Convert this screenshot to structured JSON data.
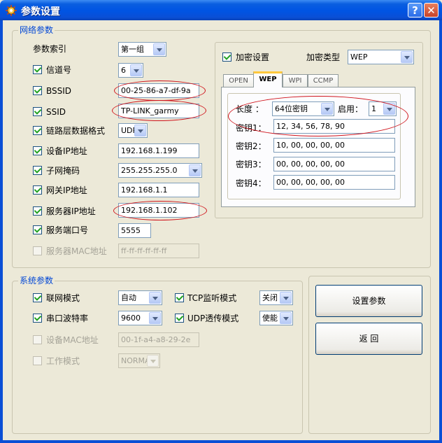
{
  "window": {
    "title": "参数设置"
  },
  "network": {
    "group_label": "网络参数",
    "param_index": {
      "label": "参数索引",
      "value": "第一组"
    },
    "channel": {
      "label": "信道号",
      "value": "6"
    },
    "bssid": {
      "label": "BSSID",
      "value": "00-25-86-a7-df-9a"
    },
    "ssid": {
      "label": "SSID",
      "value": "TP-LINK_garmy"
    },
    "link_format": {
      "label": "链路层数据格式",
      "value": "UDP"
    },
    "device_ip": {
      "label": "设备IP地址",
      "value": "192.168.1.199"
    },
    "subnet_mask": {
      "label": "子网掩码",
      "value": "255.255.255.0"
    },
    "gateway_ip": {
      "label": "网关IP地址",
      "value": "192.168.1.1"
    },
    "server_ip": {
      "label": "服务器IP地址",
      "value": "192.168.1.102"
    },
    "server_port": {
      "label": "服务端口号",
      "value": "5555"
    },
    "server_mac": {
      "label": "服务器MAC地址",
      "value": "ff-ff-ff-ff-ff-ff"
    }
  },
  "encryption": {
    "label": "加密设置",
    "type_label": "加密类型",
    "type_value": "WEP",
    "tabs": [
      "OPEN",
      "WEP",
      "WPI",
      "CCMP"
    ],
    "length_label": "长度 ：",
    "length_value": "64位密钥",
    "enable_label": "启用：",
    "enable_value": "1",
    "keys": [
      {
        "label": "密钥1：",
        "value": "12, 34, 56, 78, 90"
      },
      {
        "label": "密钥2：",
        "value": "10, 00, 00, 00, 00"
      },
      {
        "label": "密钥3：",
        "value": "00, 00, 00, 00, 00"
      },
      {
        "label": "密钥4：",
        "value": "00, 00, 00, 00, 00"
      }
    ]
  },
  "system": {
    "group_label": "系统参数",
    "network_mode": {
      "label": "联网模式",
      "value": "自动"
    },
    "tcp_listen": {
      "label": "TCP监听模式",
      "value": "关闭"
    },
    "baud_rate": {
      "label": "串口波特率",
      "value": "9600"
    },
    "udp_transparent": {
      "label": "UDP透传模式",
      "value": "使能"
    },
    "device_mac": {
      "label": "设备MAC地址",
      "value": "00-1f-a4-a8-29-2e"
    },
    "work_mode": {
      "label": "工作模式",
      "value": "NORMAL"
    }
  },
  "buttons": {
    "set_params": "设置参数",
    "back": "返 回"
  },
  "icons": {
    "help": "?",
    "close": "✕"
  },
  "colors": {
    "titlebar": "#0054e3",
    "group_label": "#0046d5",
    "annotation": "#d0141c",
    "tab_highlight": "#ffc83c"
  }
}
